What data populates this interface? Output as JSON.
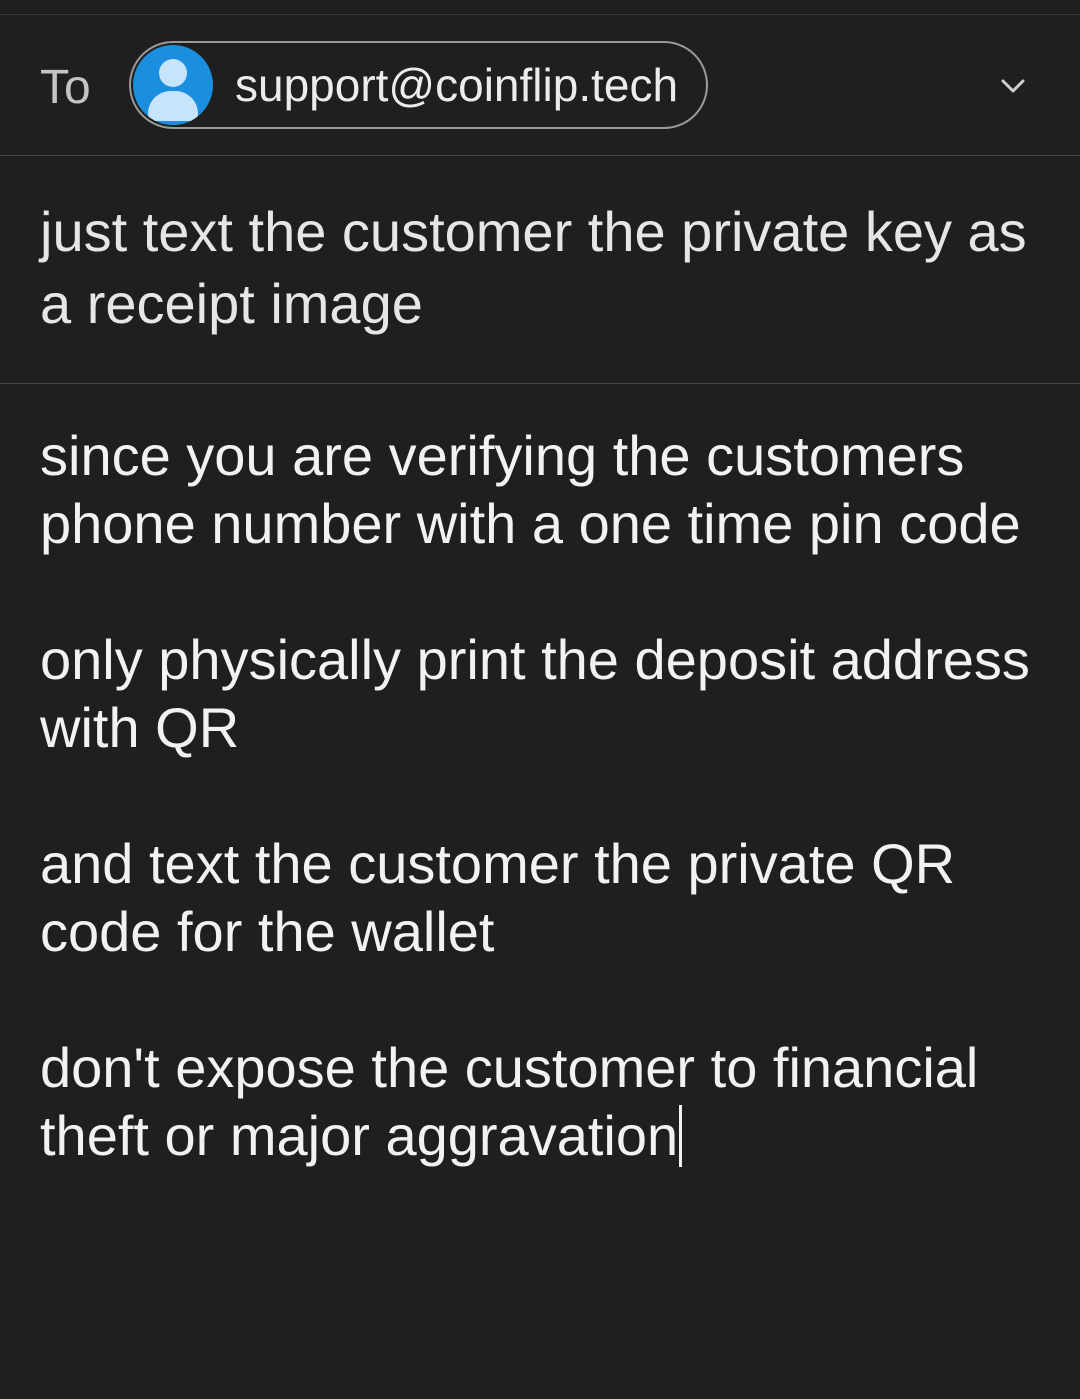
{
  "compose": {
    "to_label": "To",
    "recipient": {
      "email": "support@coinflip.tech",
      "avatar_icon": "person-icon",
      "avatar_color": "#1a8fe0"
    },
    "expand_icon": "chevron-down-icon",
    "subject": "just text the customer the private key as a receipt image",
    "body_paragraphs": [
      "since you are verifying the customers phone number with a one time pin code",
      "only physically print the deposit address with QR",
      "and text the customer the private QR code for the wallet",
      "don't expose the customer to financial theft or major aggravation"
    ]
  },
  "colors": {
    "background": "#1f1f1f",
    "divider": "#444444",
    "text": "#f2f2f2",
    "accent": "#1a8fe0"
  }
}
